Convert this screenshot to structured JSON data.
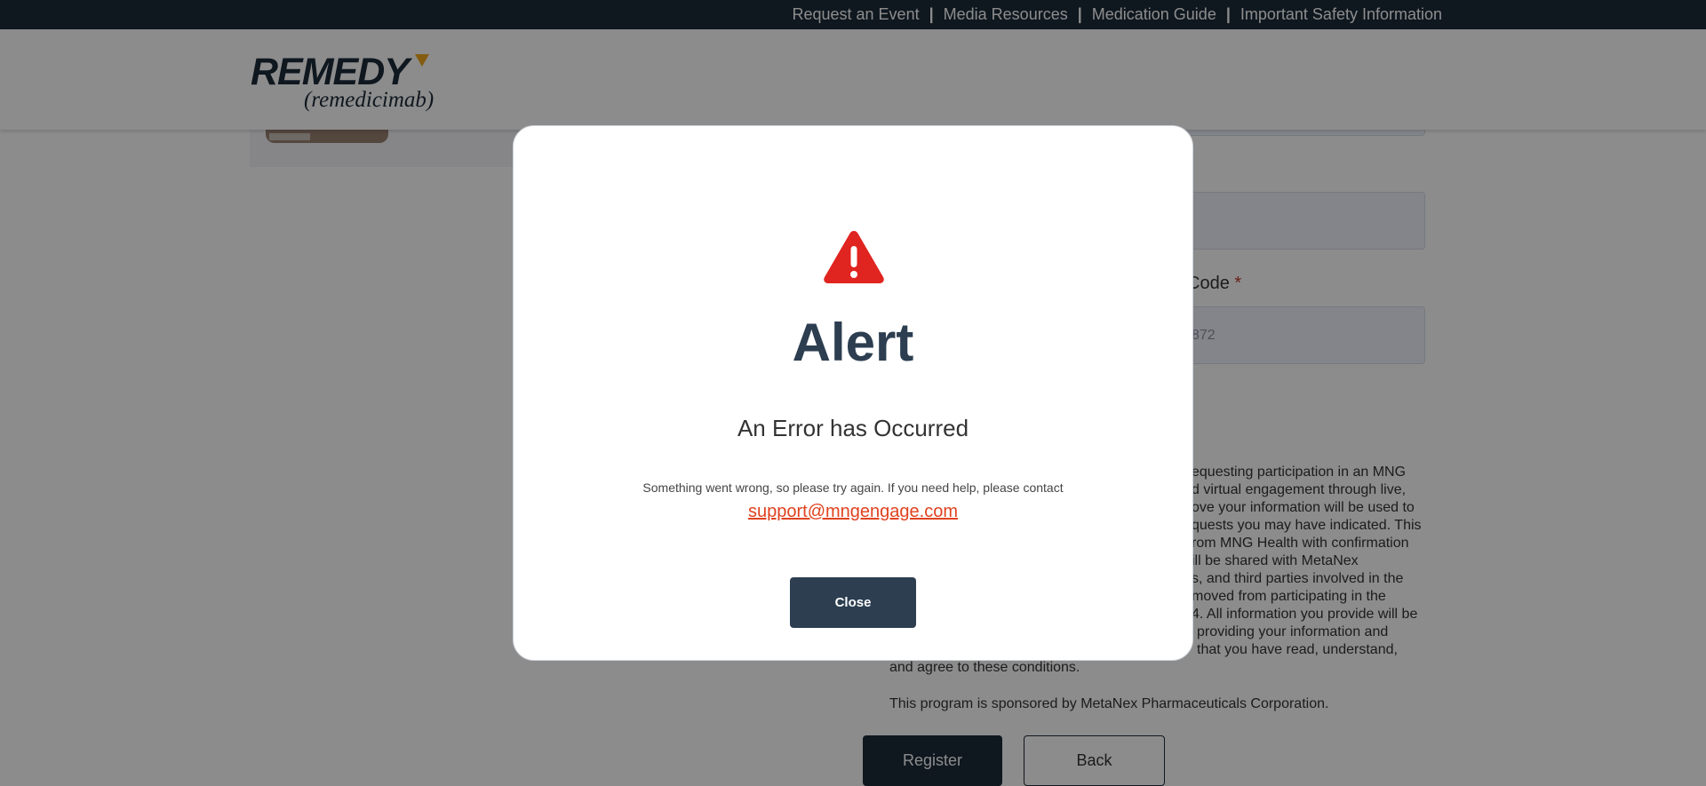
{
  "topbar": {
    "links": [
      "Request an Event",
      "Media Resources",
      "Medication Guide",
      "Important Safety Information"
    ],
    "separator": "|"
  },
  "header": {
    "logo_brand": "REMEDY",
    "logo_generic": "(remedicimab)"
  },
  "form": {
    "field_label": "Code",
    "field_required_marker": "*",
    "field_value": "872",
    "disclaimer_lines": [
      "equesting participation in an MNG",
      "d virtual engagement through live,",
      "ove your information will be used to",
      "quests you may have indicated. This",
      "rom MNG Health with confirmation",
      "ill be shared with MetaNex",
      "s, and third parties involved in the",
      "moved from participating in the",
      "4. All information you provide will be",
      "providing your information and",
      "that you have read, understand,"
    ],
    "disclaimer_last_line": "and agree to these conditions.",
    "sponsor_text": "This program is sponsored by MetaNex Pharmaceuticals Corporation.",
    "register_label": "Register",
    "back_label": "Back"
  },
  "modal": {
    "icon": "warning-triangle-icon",
    "title": "Alert",
    "subtitle": "An Error has Occurred",
    "message": "Something went wrong, so please try again. If you need help, please contact",
    "support_email": "support@mngengage.com",
    "close_label": "Close"
  },
  "colors": {
    "navy": "#1c2a3a",
    "modal_title": "#2c3e50",
    "alert_red": "#e0241f",
    "link_red": "#e0421f"
  }
}
